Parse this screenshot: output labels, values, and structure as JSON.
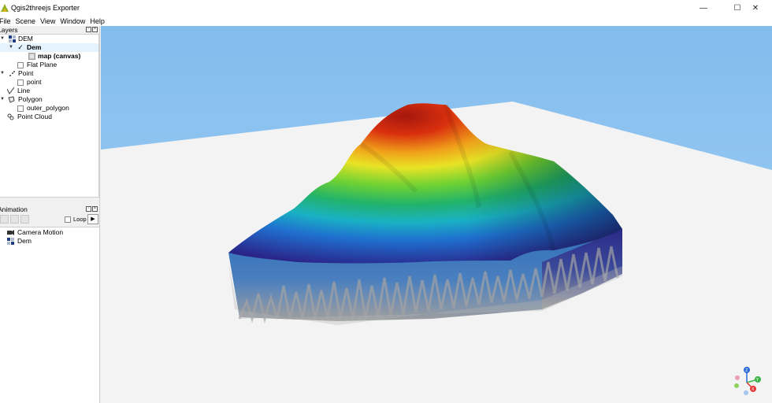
{
  "window": {
    "title": "Qgis2threejs Exporter",
    "controls": {
      "minimize": "—",
      "maximize": "☐",
      "close": "✕"
    }
  },
  "menu": [
    "File",
    "Scene",
    "View",
    "Window",
    "Help"
  ],
  "layers_panel": {
    "title": "Layers",
    "items": [
      {
        "label": "DEM"
      },
      {
        "label": "Dem"
      },
      {
        "label": "map (canvas)"
      },
      {
        "label": "Flat Plane"
      },
      {
        "label": "Point"
      },
      {
        "label": "point"
      },
      {
        "label": "Line"
      },
      {
        "label": "Polygon"
      },
      {
        "label": "outer_polygon"
      },
      {
        "label": "Point Cloud"
      }
    ]
  },
  "animation_panel": {
    "title": "Animation",
    "loop_label": "Loop",
    "play_symbol": "▶",
    "items": [
      {
        "label": "Camera Motion"
      },
      {
        "label": "Dem"
      }
    ]
  },
  "colors": {
    "sky": "#87c0ee",
    "ground": "#f4f4f4",
    "terrain_high": "#b01c0c",
    "terrain_low": "#2c238f",
    "side": "#9d9d9d"
  }
}
